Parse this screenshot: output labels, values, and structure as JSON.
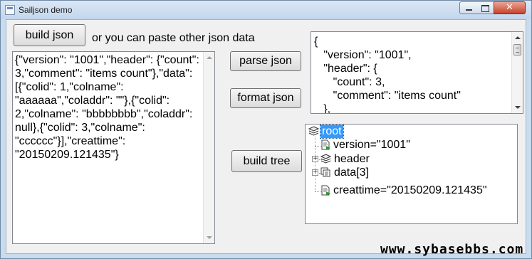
{
  "window": {
    "title": "Sailjson demo"
  },
  "controls": {
    "build_json_label": "build json",
    "hint_text": "or you can paste other json data",
    "parse_json_label": "parse json",
    "format_json_label": "format json",
    "build_tree_label": "build tree"
  },
  "raw_json": {
    "text": "{\"version\": \"1001\",\"header\": {\"count\":\n3,\"comment\": \"items count\"},\"data\":\n[{\"colid\": 1,\"colname\":\n\"aaaaaa\",\"coladdr\": \"\"},{\"colid\":\n2,\"colname\": \"bbbbbbbb\",\"coladdr\":\nnull},{\"colid\": 3,\"colname\":\n\"cccccc\"}],\"creattime\":\n\"20150209.121435\"}"
  },
  "formatted_json": {
    "lines": [
      "{",
      "   \"version\": \"1001\",",
      "   \"header\": {",
      "      \"count\": 3,",
      "      \"comment\": \"items count\"",
      "   },"
    ]
  },
  "tree": {
    "root": {
      "label": "root",
      "icon": "object-node-icon",
      "selected": true
    },
    "children": [
      {
        "label": "version=\"1001\"",
        "icon": "value-node-icon",
        "expandable": false
      },
      {
        "label": "header",
        "icon": "object-node-icon",
        "expandable": true,
        "expander": "+"
      },
      {
        "label": "data[3]",
        "icon": "array-node-icon",
        "expandable": true,
        "expander": "+"
      },
      {
        "label": "creattime=\"20150209.121435\"",
        "icon": "value-node-icon",
        "expandable": false
      }
    ]
  },
  "watermark": {
    "text": "www.sybasebbs.com"
  },
  "colors": {
    "selection": "#3399ff",
    "close_button": "#c8422b",
    "frame": "#c9dbee"
  }
}
